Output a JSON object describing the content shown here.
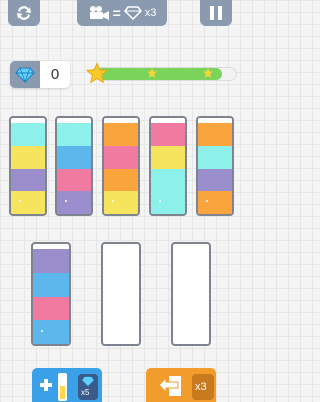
{
  "top_bar": {
    "video_offer_reward": "x3"
  },
  "gems": {
    "count": "0"
  },
  "progress": {
    "fraction": 0.9
  },
  "colors": {
    "cyan": "#8ef0ea",
    "yellow": "#f7e45e",
    "purple": "#9a8fcc",
    "blue": "#5cb8ec",
    "pink": "#f07aa0",
    "orange": "#f9a43c",
    "frame": "#7d8490",
    "button_gray": "#8a9bb0",
    "add_button": "#3aa0e8",
    "undo_button": "#f29c2c"
  },
  "tubes": [
    {
      "segments": [
        "cyan",
        "yellow",
        "purple",
        "yellow"
      ]
    },
    {
      "segments": [
        "cyan",
        "blue",
        "pink",
        "purple"
      ]
    },
    {
      "segments": [
        "orange",
        "pink",
        "orange",
        "yellow"
      ]
    },
    {
      "segments": [
        "pink",
        "yellow",
        "cyan",
        "cyan"
      ]
    },
    {
      "segments": [
        "orange",
        "cyan",
        "purple",
        "orange"
      ]
    },
    {
      "segments": [
        "purple",
        "blue",
        "pink",
        "blue"
      ]
    },
    {
      "segments": []
    },
    {
      "segments": []
    }
  ],
  "bottom_bar": {
    "add_tube_cost": "x5",
    "undo_count": "x3"
  }
}
